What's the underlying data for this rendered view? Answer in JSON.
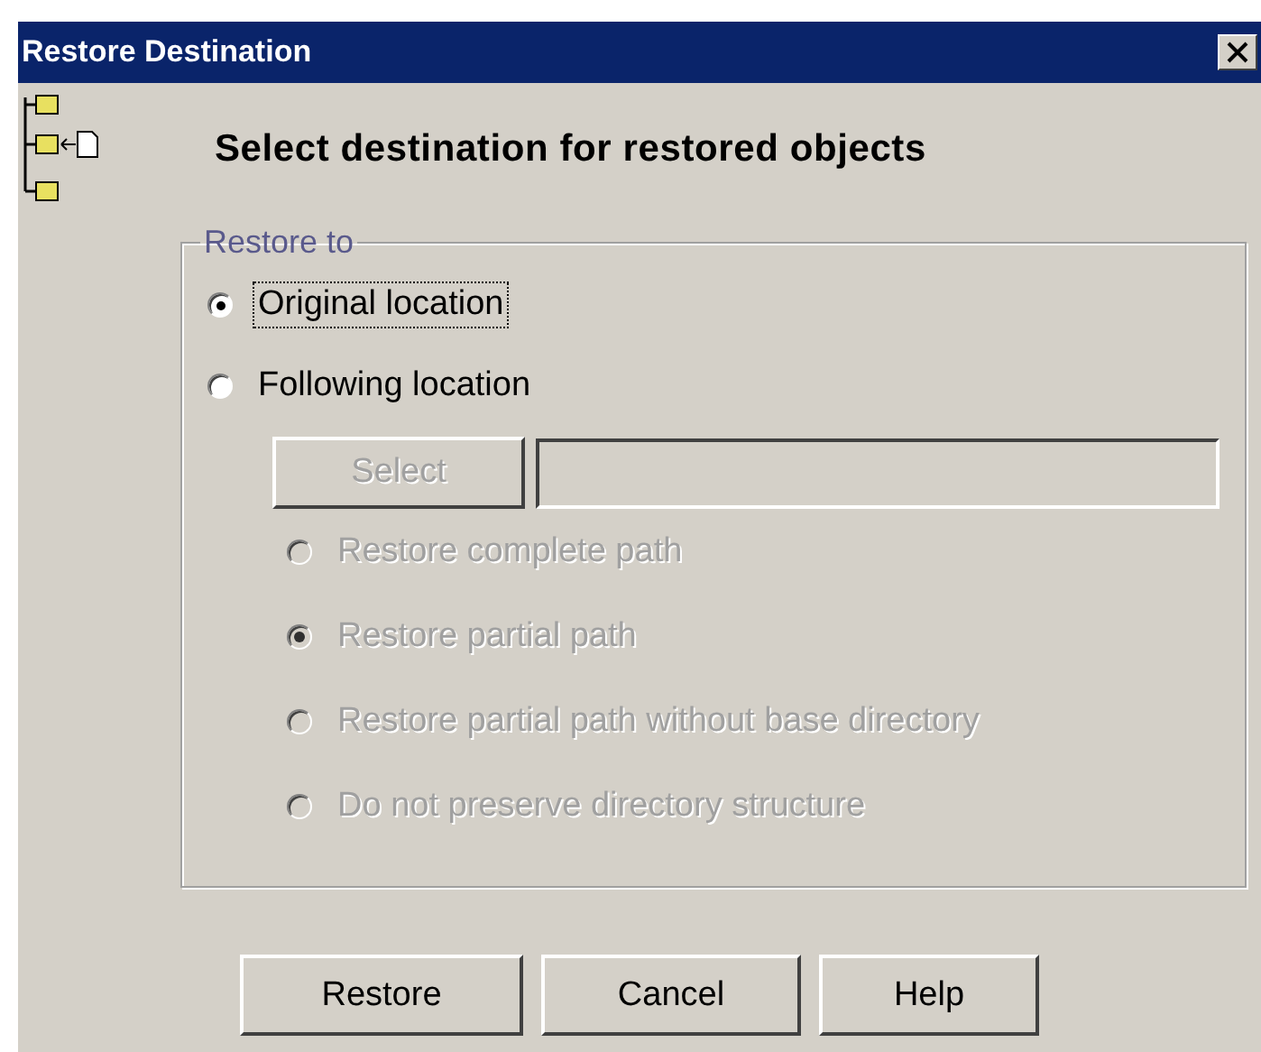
{
  "window": {
    "title": "Restore Destination"
  },
  "heading": "Select destination for restored objects",
  "group": {
    "legend": "Restore to"
  },
  "locations": [
    {
      "label": "Original location",
      "selected": true,
      "focused": true
    },
    {
      "label": "Following location",
      "selected": false,
      "focused": false
    }
  ],
  "select_button": {
    "label": "Select",
    "disabled": true
  },
  "path_options": [
    {
      "label": "Restore complete path",
      "selected": false,
      "disabled": true
    },
    {
      "label": "Restore partial path",
      "selected": true,
      "disabled": true
    },
    {
      "label": "Restore partial path without base directory",
      "selected": false,
      "disabled": true
    },
    {
      "label": "Do not preserve directory structure",
      "selected": false,
      "disabled": true
    }
  ],
  "buttons": [
    "Restore",
    "Cancel",
    "Help"
  ]
}
